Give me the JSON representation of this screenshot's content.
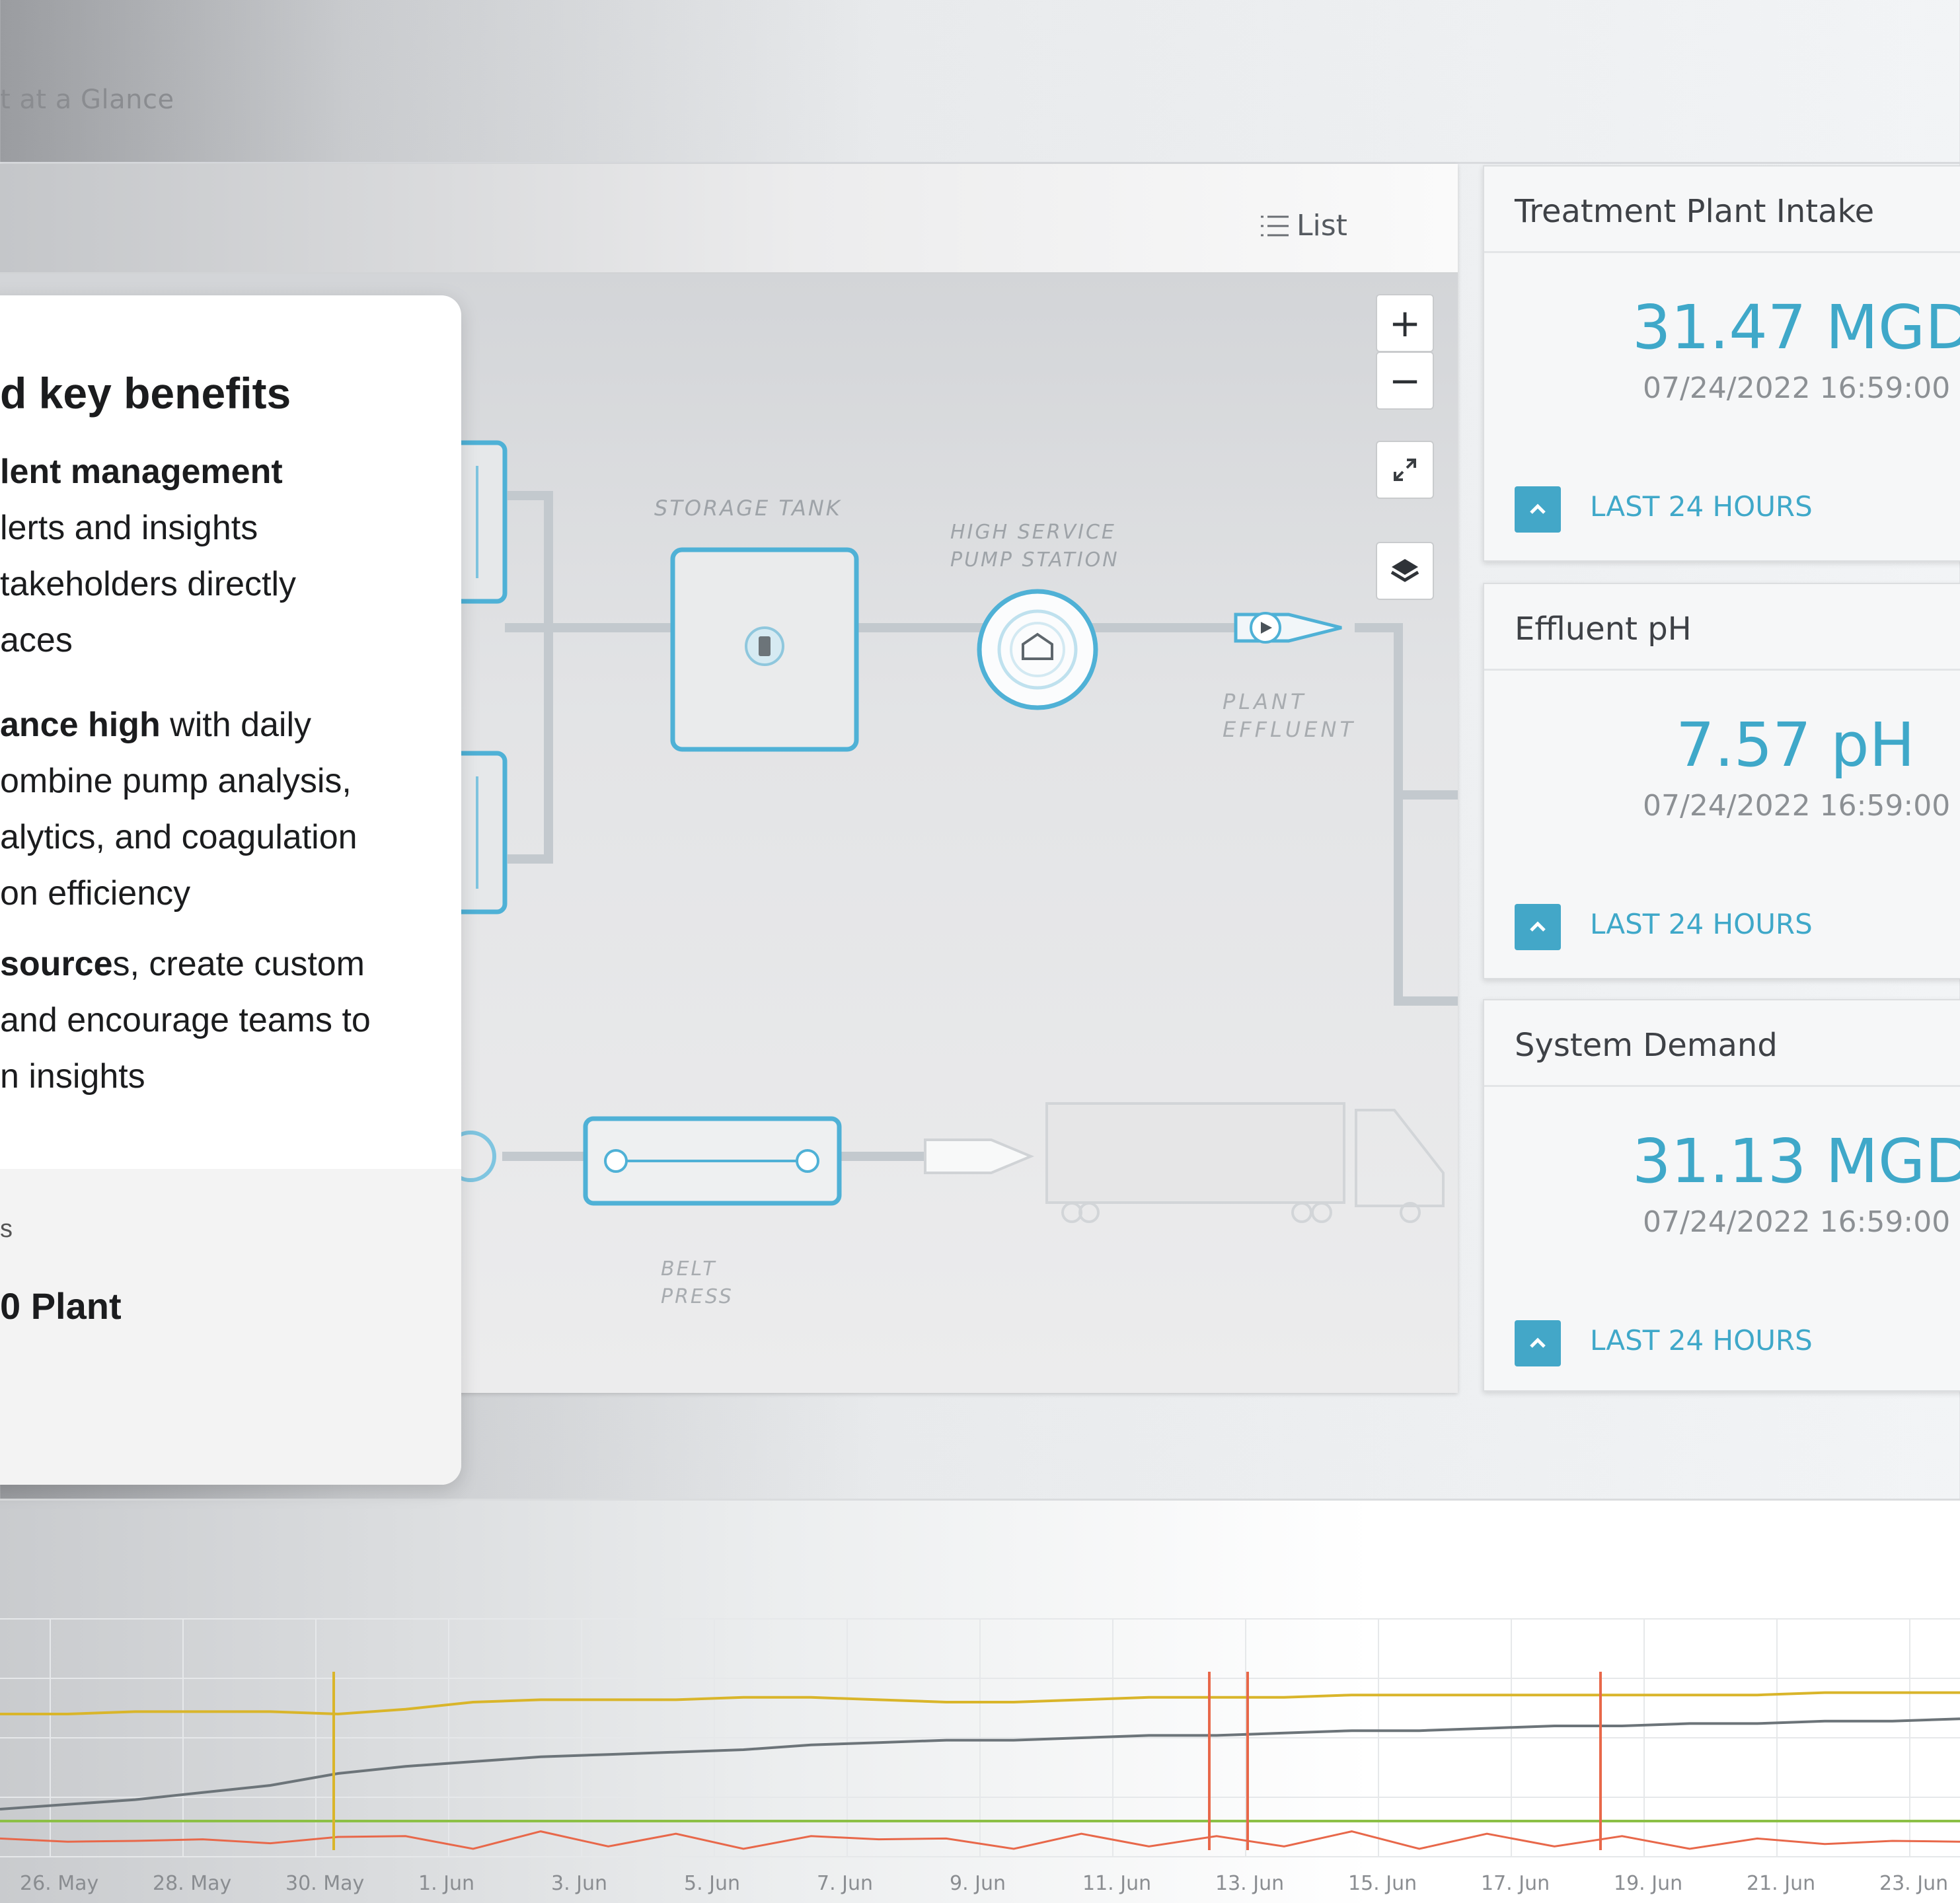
{
  "header": {
    "breadcrumb": "t at a Glance"
  },
  "map": {
    "list_label": "List",
    "zoom_in": "+",
    "zoom_out": "−",
    "labels": {
      "storage_tank": "STORAGE TANK",
      "high_service_1": "HIGH SERVICE",
      "high_service_2": "PUMP STATION",
      "plant_1": "PLANT",
      "plant_2": "EFFLUENT",
      "belt_1": "BELT",
      "belt_2": "PRESS"
    }
  },
  "cards": [
    {
      "title": "Treatment Plant Intake",
      "value": "31.47 MGD",
      "timestamp": "07/24/2022 16:59:00",
      "range": "LAST 24 HOURS"
    },
    {
      "title": "Effluent pH",
      "value": "7.57 pH",
      "timestamp": "07/24/2022 16:59:00",
      "range": "LAST 24 HOURS"
    },
    {
      "title": "System Demand",
      "value": "31.13 MGD",
      "timestamp": "07/24/2022 16:59:00",
      "range": "LAST 24 HOURS"
    }
  ],
  "info": {
    "title": "d key benefits",
    "p1_l1_bold": "lent management",
    "p1_l2": "lerts and insights",
    "p1_l3": "takeholders directly",
    "p1_l4": "aces",
    "p2_l1_bold": "ance high",
    "p2_l1_rest": " with daily",
    "p2_l2": "ombine pump analysis,",
    "p2_l3": "alytics, and coagulation",
    "p2_l4": "on efficiency",
    "p3_l1_bold": "source",
    "p3_l1_rest": "s, create custom",
    "p3_l2": "and encourage teams to",
    "p3_l3": "n insights",
    "foot_small": "s",
    "foot_title": "0 Plant"
  },
  "chart_data": {
    "type": "line",
    "x_tick_labels": [
      "26. May",
      "28. May",
      "30. May",
      "1. Jun",
      "3. Jun",
      "5. Jun",
      "7. Jun",
      "9. Jun",
      "11. Jun",
      "13. Jun",
      "15. Jun",
      "17. Jun",
      "19. Jun",
      "21. Jun",
      "23. Jun"
    ],
    "series_colors": {
      "yellow": "#d9b52a",
      "gray": "#6c7479",
      "orange": "#e8684a",
      "green": "#8cc046"
    },
    "series": [
      {
        "color": "yellow",
        "values": [
          60,
          60,
          61,
          61,
          61,
          60,
          62,
          65,
          66,
          66,
          66,
          67,
          67,
          66,
          65,
          65,
          66,
          67,
          67,
          67,
          68,
          68,
          68,
          68,
          68,
          68,
          68,
          69,
          69,
          69
        ]
      },
      {
        "color": "gray",
        "values": [
          20,
          22,
          24,
          27,
          30,
          35,
          38,
          40,
          42,
          43,
          44,
          45,
          47,
          48,
          49,
          49,
          50,
          51,
          51,
          52,
          53,
          53,
          54,
          55,
          55,
          56,
          56,
          57,
          57,
          58
        ]
      },
      {
        "color": "orange",
        "values": [
          6,
          8,
          5,
          9,
          4,
          10,
          7,
          5,
          9,
          6,
          8,
          5,
          7,
          9,
          6,
          5,
          8,
          6,
          7,
          6,
          9,
          5,
          8,
          6,
          7,
          5,
          6,
          7,
          5,
          8
        ]
      },
      {
        "color": "green",
        "values": [
          15,
          15,
          15,
          15,
          15,
          15,
          15,
          15,
          15,
          15,
          15,
          15,
          15,
          15,
          15,
          15,
          15,
          15,
          15,
          15,
          15,
          15,
          15,
          15,
          15,
          15,
          15,
          15,
          15,
          15
        ]
      }
    ],
    "grid": true
  }
}
